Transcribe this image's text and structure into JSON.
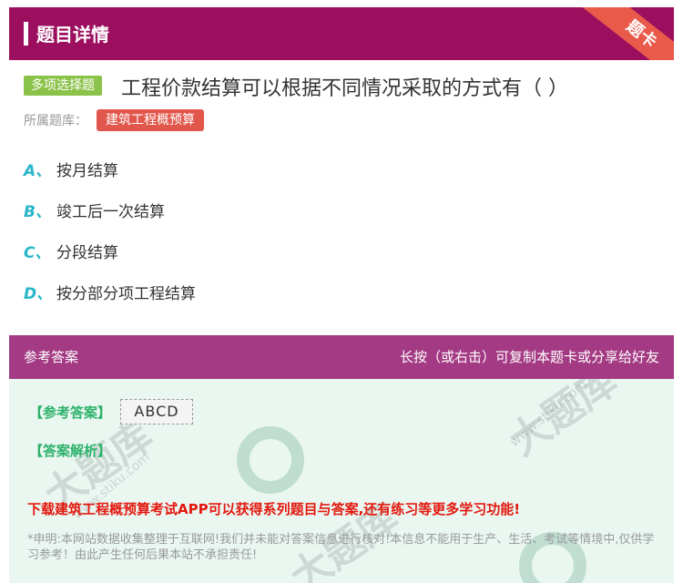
{
  "header": {
    "title": "题目详情",
    "ribbon": "题卡"
  },
  "question": {
    "type_tag": "多项选择题",
    "title": "工程价款结算可以根据不同情况采取的方式有（  ）",
    "bank_label": "所属题库：",
    "bank_tag": "建筑工程概预算",
    "options": [
      {
        "letter": "A、",
        "text": "按月结算"
      },
      {
        "letter": "B、",
        "text": "竣工后一次结算"
      },
      {
        "letter": "C、",
        "text": "分段结算"
      },
      {
        "letter": "D、",
        "text": "按分部分项工程结算"
      }
    ]
  },
  "answer": {
    "header_left": "参考答案",
    "header_right": "长按（或右击）可复制本题卡或分享给好友",
    "ref_label": "【参考答案】",
    "ref_value": "ABCD",
    "analysis_label": "【答案解析】",
    "promo": "下载建筑工程概预算考试APP可以获得系列题目与答案,还有练习等更多学习功能!",
    "disclaimer": "*申明:本网站数据收集整理于互联网!我们并未能对答案信息进行核对!本信息不能用于生产、生活、考试等情境中,仅供学习参考！由此产生任何后果本站不承担责任!"
  },
  "watermark": {
    "text": "大题库",
    "domain": "www.stiku.com"
  }
}
